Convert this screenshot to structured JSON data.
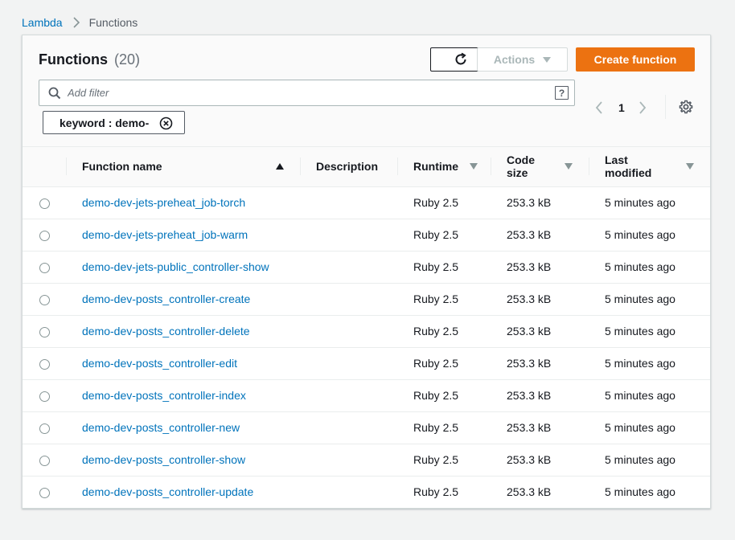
{
  "breadcrumb": {
    "root": "Lambda",
    "current": "Functions"
  },
  "header": {
    "title": "Functions",
    "count": "(20)",
    "actions_label": "Actions",
    "create_label": "Create function"
  },
  "filter": {
    "placeholder": "Add filter",
    "help_label": "?",
    "token": "keyword : demo-"
  },
  "pagination": {
    "current_page": "1"
  },
  "table": {
    "columns": {
      "name": "Function name",
      "description": "Description",
      "runtime": "Runtime",
      "code_size": "Code size",
      "last_modified": "Last modified"
    },
    "rows": [
      {
        "name": "demo-dev-jets-preheat_job-torch",
        "description": "",
        "runtime": "Ruby 2.5",
        "code_size": "253.3 kB",
        "last_modified": "5 minutes ago"
      },
      {
        "name": "demo-dev-jets-preheat_job-warm",
        "description": "",
        "runtime": "Ruby 2.5",
        "code_size": "253.3 kB",
        "last_modified": "5 minutes ago"
      },
      {
        "name": "demo-dev-jets-public_controller-show",
        "description": "",
        "runtime": "Ruby 2.5",
        "code_size": "253.3 kB",
        "last_modified": "5 minutes ago"
      },
      {
        "name": "demo-dev-posts_controller-create",
        "description": "",
        "runtime": "Ruby 2.5",
        "code_size": "253.3 kB",
        "last_modified": "5 minutes ago"
      },
      {
        "name": "demo-dev-posts_controller-delete",
        "description": "",
        "runtime": "Ruby 2.5",
        "code_size": "253.3 kB",
        "last_modified": "5 minutes ago"
      },
      {
        "name": "demo-dev-posts_controller-edit",
        "description": "",
        "runtime": "Ruby 2.5",
        "code_size": "253.3 kB",
        "last_modified": "5 minutes ago"
      },
      {
        "name": "demo-dev-posts_controller-index",
        "description": "",
        "runtime": "Ruby 2.5",
        "code_size": "253.3 kB",
        "last_modified": "5 minutes ago"
      },
      {
        "name": "demo-dev-posts_controller-new",
        "description": "",
        "runtime": "Ruby 2.5",
        "code_size": "253.3 kB",
        "last_modified": "5 minutes ago"
      },
      {
        "name": "demo-dev-posts_controller-show",
        "description": "",
        "runtime": "Ruby 2.5",
        "code_size": "253.3 kB",
        "last_modified": "5 minutes ago"
      },
      {
        "name": "demo-dev-posts_controller-update",
        "description": "",
        "runtime": "Ruby 2.5",
        "code_size": "253.3 kB",
        "last_modified": "5 minutes ago"
      }
    ]
  },
  "colors": {
    "link": "#0073bb",
    "primary_button": "#ec7211",
    "page_background": "#f2f3f3"
  }
}
